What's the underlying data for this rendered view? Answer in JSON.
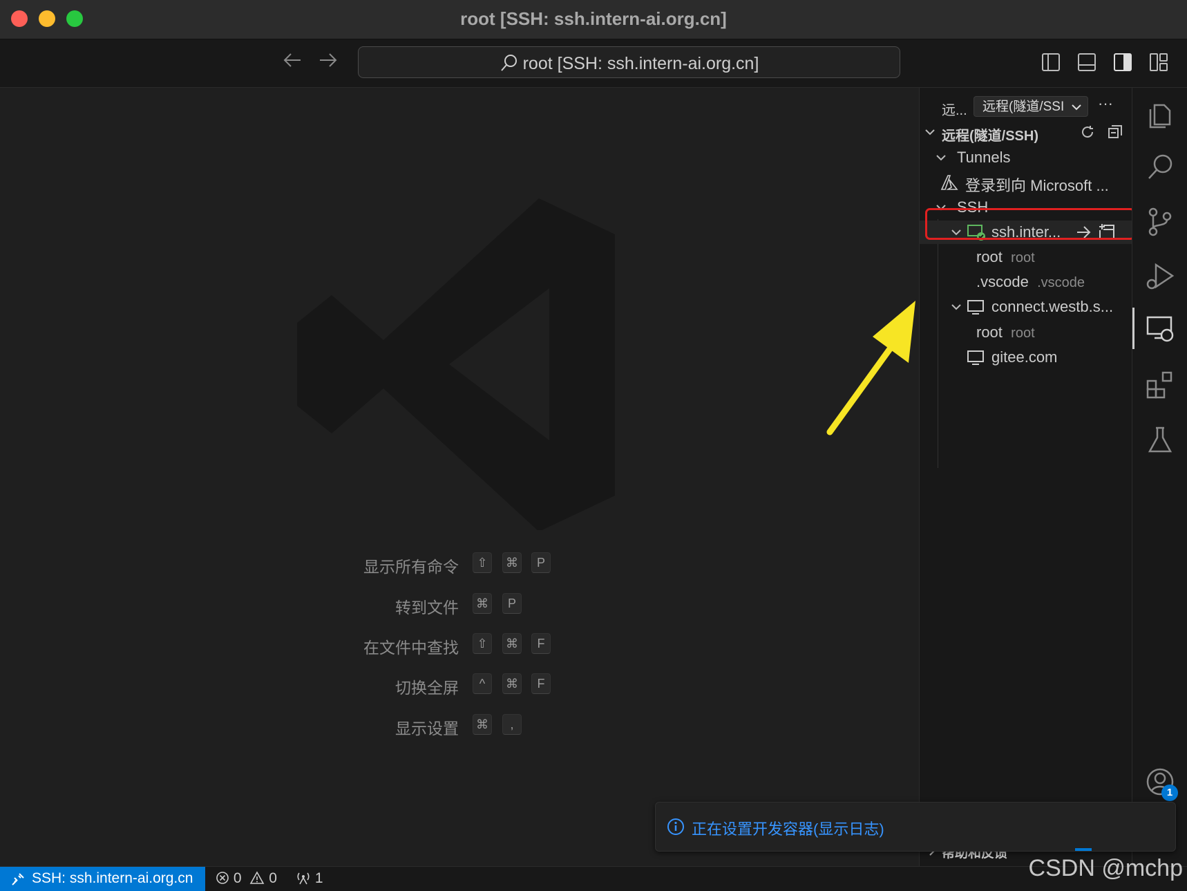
{
  "window": {
    "title": "root [SSH: ssh.intern-ai.org.cn]"
  },
  "toolbar": {
    "back_icon": "arrow-left-icon",
    "forward_icon": "arrow-right-icon",
    "search_text": "root [SSH: ssh.intern-ai.org.cn]"
  },
  "shortcuts": [
    {
      "label": "显示所有命令",
      "keys": [
        "⇧",
        "⌘",
        "P"
      ]
    },
    {
      "label": "转到文件",
      "keys": [
        "⌘",
        "P"
      ]
    },
    {
      "label": "在文件中查找",
      "keys": [
        "⇧",
        "⌘",
        "F"
      ]
    },
    {
      "label": "切换全屏",
      "keys": [
        "^",
        "⌘",
        "F"
      ]
    },
    {
      "label": "显示设置",
      "keys": [
        "⌘",
        ","
      ]
    }
  ],
  "sidebar": {
    "header_short": "远...",
    "dropdown": "远程(隧道/SSI",
    "more": "···",
    "section_title": "远程(隧道/SSH)",
    "tunnels": {
      "label": "Tunnels",
      "signin": "登录到向 Microsoft ..."
    },
    "ssh": {
      "label": "SSH",
      "hosts": [
        {
          "name": "ssh.inter...",
          "connected": true,
          "folders": [
            {
              "name": "root",
              "desc": "root"
            },
            {
              "name": ".vscode",
              "desc": ".vscode"
            }
          ]
        },
        {
          "name": "connect.westb.s...",
          "connected": false,
          "folders": [
            {
              "name": "root",
              "desc": "root"
            }
          ]
        },
        {
          "name": "gitee.com",
          "connected": false,
          "folders": []
        }
      ]
    },
    "footer": "帮助和反馈"
  },
  "activity": {
    "icons": [
      "explorer-icon",
      "search-icon",
      "source-control-icon",
      "run-debug-icon",
      "remote-explorer-icon",
      "extensions-icon",
      "testing-icon"
    ],
    "account_badge": "1"
  },
  "notification": {
    "text": "正在设置开发容器(显示日志)"
  },
  "statusbar": {
    "remote": "SSH: ssh.intern-ai.org.cn",
    "errors": "0",
    "warnings": "0",
    "ports": "1"
  },
  "watermark": "CSDN @mchp",
  "colors": {
    "accent": "#0078d4",
    "highlight": "#e02020",
    "arrow": "#f7e524",
    "connected": "#5fb85f"
  }
}
